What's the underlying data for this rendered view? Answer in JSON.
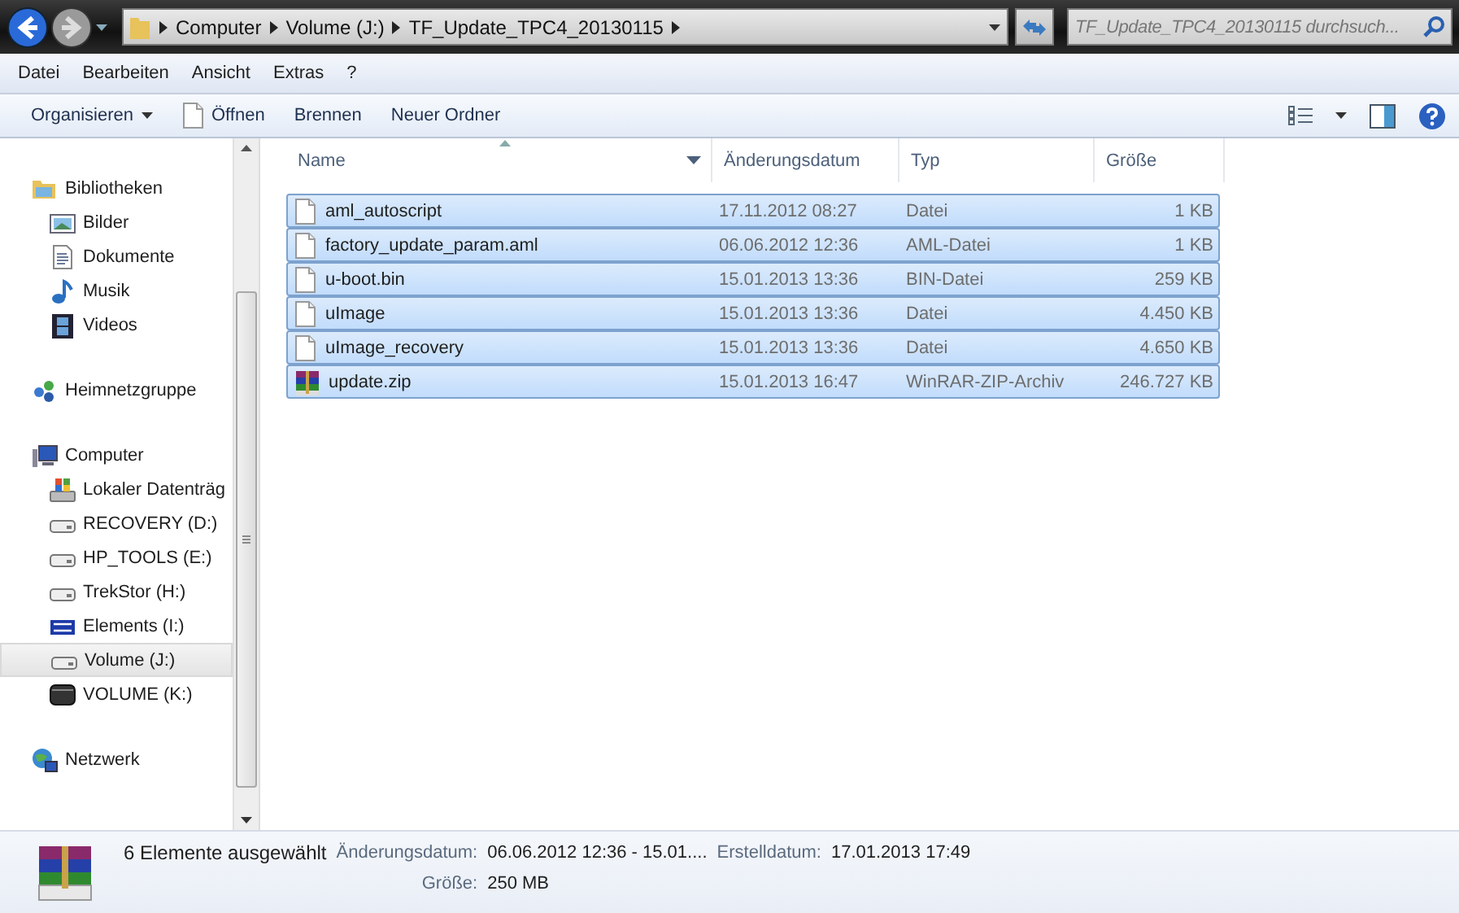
{
  "address_bar": {
    "crumbs": [
      "Computer",
      "Volume (J:)",
      "TF_Update_TPC4_20130115"
    ]
  },
  "search": {
    "placeholder": "TF_Update_TPC4_20130115 durchsuch..."
  },
  "menu": [
    "Datei",
    "Bearbeiten",
    "Ansicht",
    "Extras",
    "?"
  ],
  "toolbar": [
    {
      "label": "Organisieren",
      "kind": "dropdown"
    },
    {
      "label": "Öffnen",
      "kind": "open"
    },
    {
      "label": "Brennen",
      "kind": "plain"
    },
    {
      "label": "Neuer Ordner",
      "kind": "plain"
    }
  ],
  "sidebar": {
    "items": [
      {
        "label": "Bibliotheken",
        "kind": "library",
        "selected": false,
        "children": [
          {
            "label": "Bilder",
            "kind": "pictures",
            "selected": false
          },
          {
            "label": "Dokumente",
            "kind": "documents",
            "selected": false
          },
          {
            "label": "Musik",
            "kind": "music",
            "selected": false
          },
          {
            "label": "Videos",
            "kind": "videos",
            "selected": false
          }
        ]
      },
      {
        "label": "Heimnetzgruppe",
        "kind": "homegroup",
        "selected": false
      },
      {
        "label": "Computer",
        "kind": "computer",
        "selected": false,
        "children": [
          {
            "label": "Lokaler Datenträg",
            "kind": "system-drive",
            "selected": false
          },
          {
            "label": "RECOVERY (D:)",
            "kind": "drive",
            "selected": false
          },
          {
            "label": "HP_TOOLS (E:)",
            "kind": "drive",
            "selected": false
          },
          {
            "label": "TrekStor (H:)",
            "kind": "drive",
            "selected": false
          },
          {
            "label": "Elements (I:)",
            "kind": "wd-drive",
            "selected": false
          },
          {
            "label": "Volume (J:)",
            "kind": "drive",
            "selected": true
          },
          {
            "label": "VOLUME (K:)",
            "kind": "dark-drive",
            "selected": false
          }
        ]
      },
      {
        "label": "Netzwerk",
        "kind": "network",
        "selected": false
      }
    ]
  },
  "table": {
    "columns": [
      {
        "label": "Name",
        "sorted": true,
        "filter_arrow": true
      },
      {
        "label": "Änderungsdatum",
        "sorted": false,
        "filter_arrow": false
      },
      {
        "label": "Typ",
        "sorted": false,
        "filter_arrow": false
      },
      {
        "label": "Größe",
        "sorted": false,
        "filter_arrow": false
      }
    ],
    "rows": [
      {
        "name": "aml_autoscript",
        "date": "17.11.2012 08:27",
        "type": "Datei",
        "size": "1 KB",
        "kind": "file",
        "selected": true
      },
      {
        "name": "factory_update_param.aml",
        "date": "06.06.2012 12:36",
        "type": "AML-Datei",
        "size": "1 KB",
        "kind": "file",
        "selected": true
      },
      {
        "name": "u-boot.bin",
        "date": "15.01.2013 13:36",
        "type": "BIN-Datei",
        "size": "259 KB",
        "kind": "file",
        "selected": true
      },
      {
        "name": "uImage",
        "date": "15.01.2013 13:36",
        "type": "Datei",
        "size": "4.450 KB",
        "kind": "file",
        "selected": true
      },
      {
        "name": "uImage_recovery",
        "date": "15.01.2013 13:36",
        "type": "Datei",
        "size": "4.650 KB",
        "kind": "file",
        "selected": true
      },
      {
        "name": "update.zip",
        "date": "15.01.2013 16:47",
        "type": "WinRAR-ZIP-Archiv",
        "size": "246.727 KB",
        "kind": "archive",
        "selected": true
      }
    ]
  },
  "details": {
    "summary": "6 Elemente ausgewählt",
    "fields": [
      {
        "label": "Änderungsdatum:",
        "value": "06.06.2012 12:36 - 15.01...."
      },
      {
        "label": "Erstelldatum:",
        "value": "17.01.2013 17:49"
      },
      {
        "label": "Größe:",
        "value": "250 MB"
      }
    ]
  }
}
